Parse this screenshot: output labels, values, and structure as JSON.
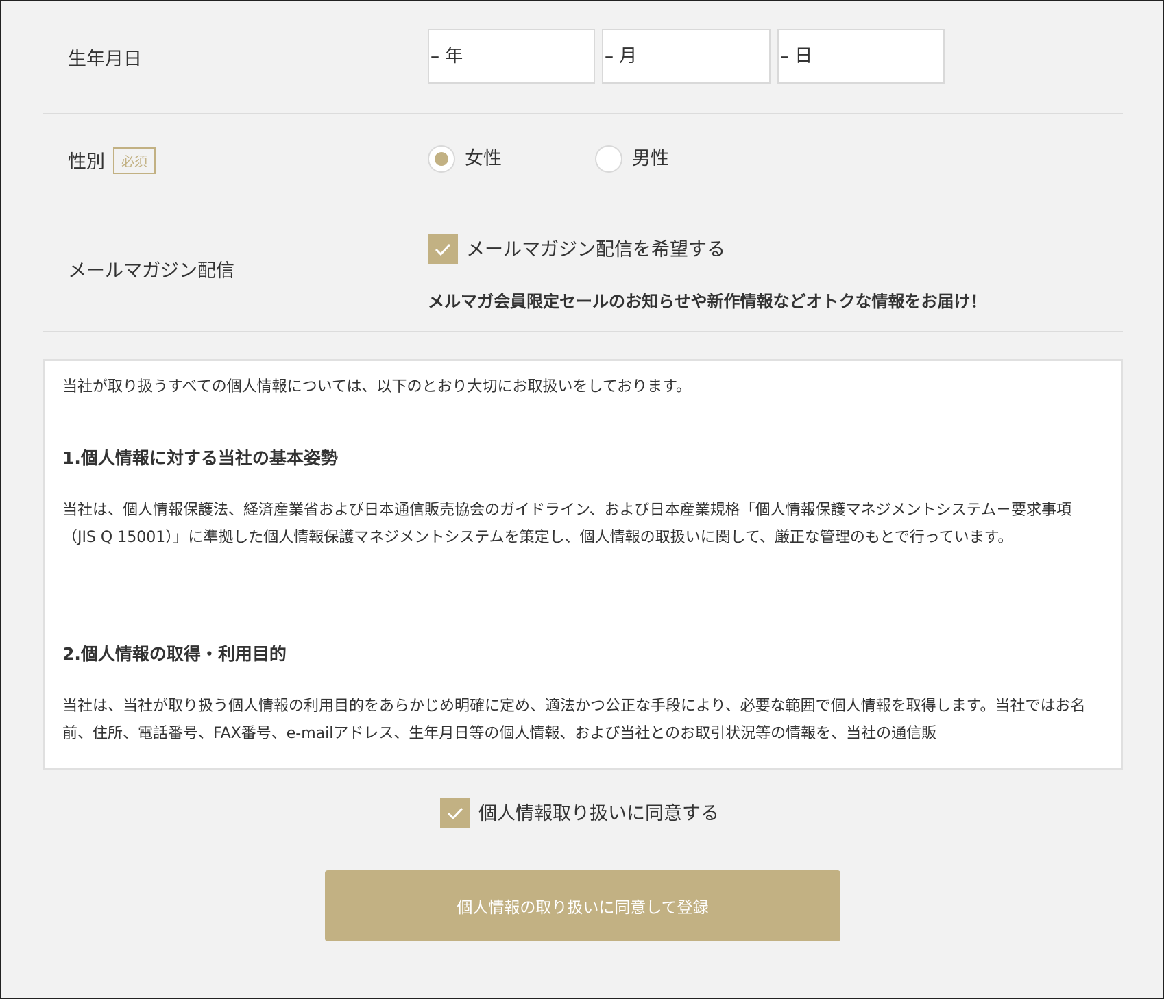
{
  "birthdate": {
    "label": "生年月日",
    "year_placeholder": "– 年",
    "month_placeholder": "– 月",
    "day_placeholder": "– 日"
  },
  "gender": {
    "label": "性別",
    "required_badge": "必須",
    "options": [
      {
        "label": "女性",
        "selected": true
      },
      {
        "label": "男性",
        "selected": false
      }
    ]
  },
  "newsletter": {
    "label": "メールマガジン配信",
    "checkbox_label": "メールマガジン配信を希望する",
    "checked": true,
    "promo": "メルマガ会員限定セールのお知らせや新作情報などオトクな情報をお届け！"
  },
  "policy": {
    "intro": "当社が取り扱うすべての個人情報については、以下のとおり大切にお取扱いをしております。",
    "section1_heading": "1.個人情報に対する当社の基本姿勢",
    "section1_body": "当社は、個人情報保護法、経済産業省および日本通信販売協会のガイドライン、および日本産業規格「個人情報保護マネジメントシステム－要求事項（JIS Q 15001）」に準拠した個人情報保護マネジメントシステムを策定し、個人情報の取扱いに関して、厳正な管理のもとで行っています。",
    "section2_heading": "2.個人情報の取得・利用目的",
    "section2_body": "当社は、当社が取り扱う個人情報の利用目的をあらかじめ明確に定め、適法かつ公正な手段により、必要な範囲で個人情報を取得します。当社ではお名前、住所、電話番号、FAX番号、e-mailアドレス、生年月日等の個人情報、および当社とのお取引状況等の情報を、当社の通信販"
  },
  "consent": {
    "checkbox_label": "個人情報取り扱いに同意する",
    "checked": true
  },
  "submit": {
    "label": "個人情報の取り扱いに同意して登録"
  },
  "colors": {
    "accent": "#c2b183",
    "background": "#f2f2f2",
    "text": "#333333"
  }
}
